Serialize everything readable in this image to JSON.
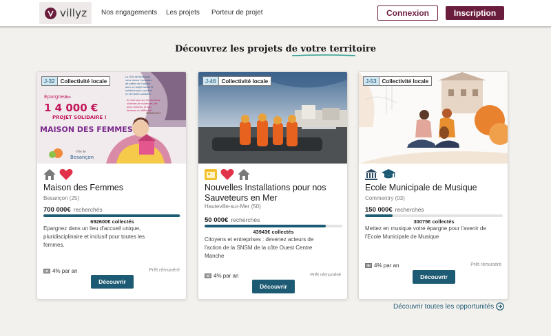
{
  "app": {
    "logo_text": "villyz"
  },
  "nav": {
    "items": [
      "Nos engagements",
      "Les projets",
      "Porteur de projet"
    ],
    "login": "Connexion",
    "signup": "Inscription"
  },
  "section": {
    "title_prefix": "Découvrez les projets de ",
    "title_highlight": "votre territoire"
  },
  "colors": {
    "brand": "#6b1d3e",
    "accent": "#1d5a73",
    "heart": "#e0334a"
  },
  "cards": [
    {
      "days": "J-32",
      "type": "Collectivité locale",
      "icons": [
        "house-icon",
        "heart-icon"
      ],
      "title_lines": [
        "Maison des Femmes"
      ],
      "location": "Besançon (25)",
      "amount": "700 000€",
      "amount_label": "recherchés",
      "progress_pct": 99,
      "collected": "692600€ collectés",
      "description_lines": [
        "Epargnez dans un lieu d'accueil unique,",
        "pluridisciplinaire et inclusif pour toutes les",
        "femmes."
      ],
      "rate": "4% par an",
      "loan_type": "Prêt rémunéré",
      "button": "Découvrir",
      "image_text": {
        "epargnez": "Épargnez",
        "des": "dès",
        "amount": "1 4 000 €",
        "projet": "PROJET SOLIDAIRE !",
        "maison": "MAISON DES FEMMES",
        "city": "Besançon",
        "ville": "Ville de",
        "decouvrir": "découvrir",
        "info_lines": [
          "La Ville de Besançon",
          "vous donne l'occasion",
          "de prêter de l'argent",
          "pour un projet social et",
          "solidaire pour soutenir",
          "un territoire solidaire."
        ],
        "mid_lines": [
          "En tant que sur les femmes",
          "victimes de violences, de",
          "leurs enfants, et des",
          "femmes en difficulté"
        ]
      }
    },
    {
      "days": "J-46",
      "type": "Collectivité locale",
      "icons": [
        "calendar-icon",
        "heart-icon",
        "house-icon"
      ],
      "title_lines": [
        "Nouvelles Installations pour nos",
        "Sauveteurs en Mer"
      ],
      "location": "Hauteville-sur-Mer (50)",
      "amount": "50 000€",
      "amount_label": "recherchés",
      "progress_pct": 88,
      "collected": "43943€ collectés",
      "description_lines": [
        "Citoyens et entreprises : devenez acteurs de",
        "l'action de la SNSM de la côte Ouest Centre",
        "Manche"
      ],
      "rate": "4% par an",
      "loan_type": "Prêt rémunéré",
      "button": "Découvrir"
    },
    {
      "days": "J-53",
      "type": "Collectivité locale",
      "icons": [
        "museum-icon",
        "graduation-cap-icon"
      ],
      "title_lines": [
        "Ecole Municipale de Musique"
      ],
      "location": "Commentry (03)",
      "amount": "150 000€",
      "amount_label": "recherchés",
      "progress_pct": 20,
      "collected": "30075€ collectés",
      "description_lines": [
        "Mettez en musique votre épargne pour l'avenir de",
        "l'Ecole Municipale de Musique"
      ],
      "rate": "4% par an",
      "loan_type": "Prêt rémunéré",
      "button": "Découvrir"
    }
  ],
  "all_link": "Découvrir toutes les opportunités"
}
